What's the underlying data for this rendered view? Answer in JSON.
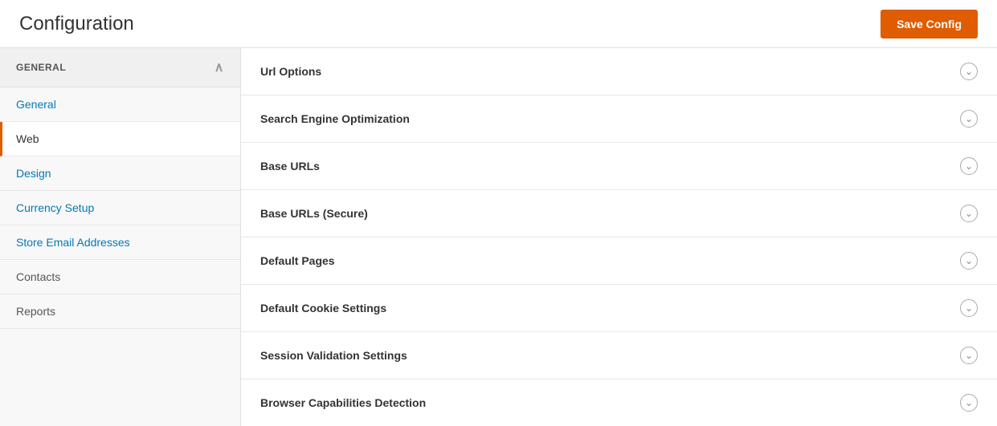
{
  "header": {
    "title": "Configuration",
    "save_button_label": "Save Config"
  },
  "sidebar": {
    "section_label": "GENERAL",
    "chevron_symbol": "∧",
    "items": [
      {
        "id": "general",
        "label": "General",
        "active": false,
        "clickable": true
      },
      {
        "id": "web",
        "label": "Web",
        "active": true,
        "clickable": true
      },
      {
        "id": "design",
        "label": "Design",
        "active": false,
        "clickable": true
      },
      {
        "id": "currency-setup",
        "label": "Currency Setup",
        "active": false,
        "clickable": true
      },
      {
        "id": "store-email-addresses",
        "label": "Store Email Addresses",
        "active": false,
        "clickable": true
      },
      {
        "id": "contacts",
        "label": "Contacts",
        "active": false,
        "clickable": false
      },
      {
        "id": "reports",
        "label": "Reports",
        "active": false,
        "clickable": false
      }
    ]
  },
  "accordion": {
    "rows": [
      {
        "id": "url-options",
        "label": "Url Options"
      },
      {
        "id": "seo",
        "label": "Search Engine Optimization"
      },
      {
        "id": "base-urls",
        "label": "Base URLs"
      },
      {
        "id": "base-urls-secure",
        "label": "Base URLs (Secure)"
      },
      {
        "id": "default-pages",
        "label": "Default Pages"
      },
      {
        "id": "default-cookie-settings",
        "label": "Default Cookie Settings"
      },
      {
        "id": "session-validation",
        "label": "Session Validation Settings"
      },
      {
        "id": "browser-capabilities",
        "label": "Browser Capabilities Detection"
      }
    ],
    "chevron_symbol": "⌄"
  }
}
